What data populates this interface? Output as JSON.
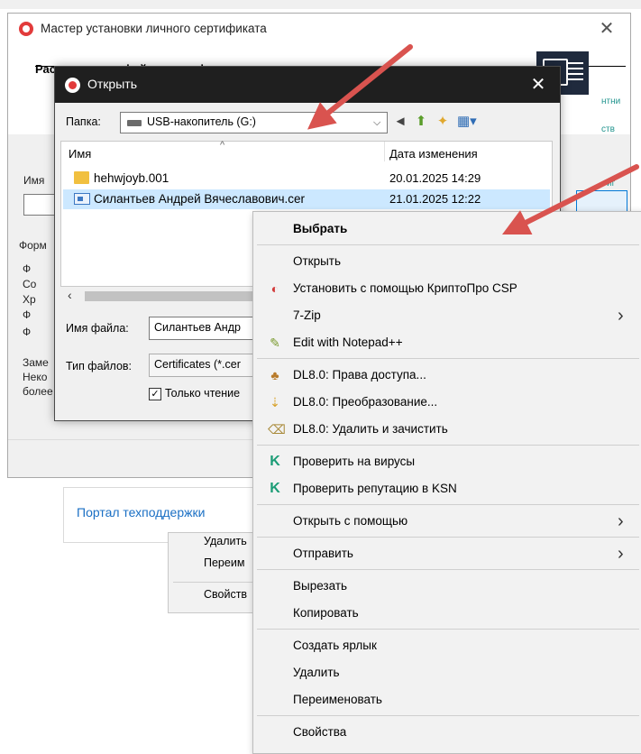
{
  "background": {
    "portal_link": "Портал техподдержки",
    "menu_items": [
      "Удалить",
      "Переим",
      "Свойств"
    ]
  },
  "wizard": {
    "title": "Мастер установки личного сертификата",
    "heading": "Расположение файла сертификата",
    "label_imya": "Имя",
    "peek_right": [
      "нтни",
      "ств",
      "иг"
    ],
    "left_labels": [
      "Форм",
      "Ф",
      "Со",
      "Хр",
      "Ф",
      "Ф",
      "Заме",
      "Неко",
      "более"
    ]
  },
  "open_dialog": {
    "title": "Открыть",
    "folder_label": "Папка:",
    "folder_value": "USB-накопитель (G:)",
    "col_name": "Имя",
    "col_date": "Дата изменения",
    "files": [
      {
        "name": "hehwjoyb.001",
        "date": "20.01.2025 14:29",
        "type": "folder"
      },
      {
        "name": "Силантьев Андрей Вячеславович.cer",
        "date": "21.01.2025 12:22",
        "type": "cert"
      }
    ],
    "filename_label": "Имя файла:",
    "filename_value": "Силантьев Андр",
    "filetype_label": "Тип файлов:",
    "filetype_value": "Certificates (*.cer",
    "readonly_label": "Только чтение"
  },
  "context_menu": {
    "items": [
      {
        "label": "Выбрать",
        "bold": true,
        "icon": "",
        "submenu": false
      },
      {
        "sep": true
      },
      {
        "label": "Открыть",
        "icon": "",
        "submenu": false
      },
      {
        "label": "Установить с помощью КриптоПро CSP",
        "icon": "cryptopro-icon",
        "submenu": false
      },
      {
        "label": "7-Zip",
        "icon": "",
        "submenu": true
      },
      {
        "label": "Edit with Notepad++",
        "icon": "notepad-icon",
        "submenu": false
      },
      {
        "sep": true
      },
      {
        "label": "DL8.0: Права доступа...",
        "icon": "users-icon",
        "submenu": false
      },
      {
        "label": "DL8.0: Преобразование...",
        "icon": "convert-icon",
        "submenu": false
      },
      {
        "label": "DL8.0: Удалить и зачистить",
        "icon": "wipe-icon",
        "submenu": false
      },
      {
        "sep": true
      },
      {
        "label": "Проверить на вирусы",
        "icon": "kaspersky-icon",
        "submenu": false
      },
      {
        "label": "Проверить репутацию в KSN",
        "icon": "kaspersky-icon",
        "submenu": false
      },
      {
        "sep": true
      },
      {
        "label": "Открыть с помощью",
        "icon": "",
        "submenu": true
      },
      {
        "sep": true
      },
      {
        "label": "Отправить",
        "icon": "",
        "submenu": true
      },
      {
        "sep": true
      },
      {
        "label": "Вырезать",
        "icon": "",
        "submenu": false
      },
      {
        "label": "Копировать",
        "icon": "",
        "submenu": false
      },
      {
        "sep": true
      },
      {
        "label": "Создать ярлык",
        "icon": "",
        "submenu": false
      },
      {
        "label": "Удалить",
        "icon": "",
        "submenu": false
      },
      {
        "label": "Переименовать",
        "icon": "",
        "submenu": false
      },
      {
        "sep": true
      },
      {
        "label": "Свойства",
        "icon": "",
        "submenu": false
      }
    ]
  },
  "colors": {
    "arrow": "#d9534f",
    "kaspersky": "#1b9c76",
    "selection": "#cce8ff"
  }
}
